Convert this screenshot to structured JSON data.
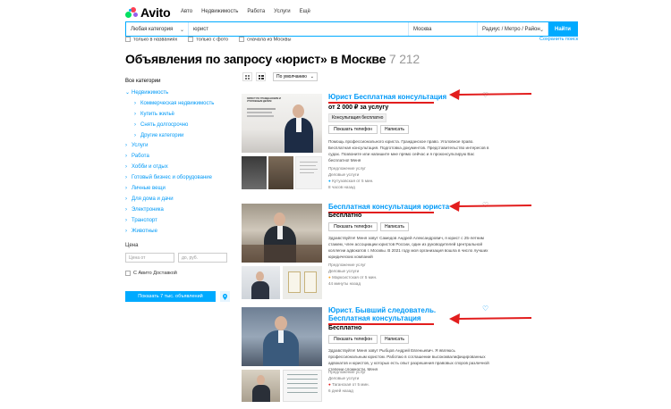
{
  "header": {
    "logo": "Avito",
    "nav": [
      "Авто",
      "Недвижимость",
      "Работа",
      "Услуги",
      "Ещё"
    ]
  },
  "search": {
    "category": "Любая категория",
    "query": "юрист",
    "city": "Москва",
    "radius": "Радиус / Метро / Район",
    "button": "Найти",
    "options": [
      "только в названиях",
      "только с фото",
      "сначала из Москвы"
    ],
    "save": "Сохранить поиск"
  },
  "page_title": "Объявления по запросу «юрист» в Москве",
  "page_count": "7 212",
  "sidebar": {
    "all": "Все категории",
    "items": [
      {
        "label": "Недвижимость",
        "level": 0,
        "open": true
      },
      {
        "label": "Коммерческая недвижимость",
        "level": 1
      },
      {
        "label": "Купить жильё",
        "level": 1
      },
      {
        "label": "Снять долгосрочно",
        "level": 1
      },
      {
        "label": "Другие категории",
        "level": 1
      },
      {
        "label": "Услуги",
        "level": 0
      },
      {
        "label": "Работа",
        "level": 0
      },
      {
        "label": "Хобби и отдых",
        "level": 0
      },
      {
        "label": "Готовый бизнес и оборудование",
        "level": 0
      },
      {
        "label": "Личные вещи",
        "level": 0
      },
      {
        "label": "Для дома и дачи",
        "level": 0
      },
      {
        "label": "Электроника",
        "level": 0
      },
      {
        "label": "Транспорт",
        "level": 0
      },
      {
        "label": "Животные",
        "level": 0
      }
    ],
    "price_label": "Цена",
    "price_from": "Цена от",
    "price_to": "до, руб.",
    "delivery": "С Авито Доставкой",
    "show_button": "Показать 7 тыс. объявлений"
  },
  "sort": {
    "selected": "По умолчанию"
  },
  "listings": [
    {
      "title": "Юрист Бесплатная консультация",
      "price": "от 2 000 ₽ за услугу",
      "tag": "Консультация бесплатно",
      "btn_phone": "Показать телефон",
      "btn_write": "Написать",
      "desc": "Помощь профессионального юриста. Гражданское право. Уголовное право. Бесплатная консультация. Подготовка документов. Представительство интересов в судах. Позвоните или напишите мне прямо сейчас и я проконсультирую Вас бесплатно! Меня",
      "seller": "Предложение услуг",
      "company": "Деловые услуги",
      "metro": "Кутузовская",
      "distance": "от 5 мин.",
      "time": "8 часов назад",
      "photo_caption": "ЮРИСТ ПО ГРАЖДАНСКИМ И УГОЛОВНЫМ ДЕЛАМ"
    },
    {
      "title": "Бесплатная консультация юриста",
      "price": "Бесплатно",
      "btn_phone": "Показать телефон",
      "btn_write": "Написать",
      "desc": "Здравствуйте! Меня зовут Самедов Андрей Александрович, я юрист с 25-летним стажем, член ассоциации юристов России, один из руководителей Центральной коллегии адвокатов г. Москвы. В 2021 году моя организация вошла в число лучших юридических компаний",
      "seller": "Предложение услуг",
      "company": "Деловые услуги",
      "metro": "Марксистская",
      "distance": "от 5 мин.",
      "time": "44 минуты назад"
    },
    {
      "title": "Юрист. Бывший следователь. Бесплатная консультация",
      "price": "Бесплатно",
      "btn_phone": "Показать телефон",
      "btn_write": "Написать",
      "desc": "Здравствуйте! Меня зовут Рыбцов Андрей Евгеньевич. Я являюсь профессиональным юристом. Работаю в соглашении высококвалифицированных адвокатов и юристов, у которых есть опыт разрешения правовых споров различной степени сложности. Меня",
      "seller": "Предложение услуг",
      "company": "Деловые услуги",
      "metro": "Таганская",
      "distance": "от 5 мин.",
      "time": "6 дней назад"
    }
  ],
  "colors": {
    "accent": "#00aaff",
    "link": "#0099f7",
    "annotation": "#e21d1d"
  }
}
